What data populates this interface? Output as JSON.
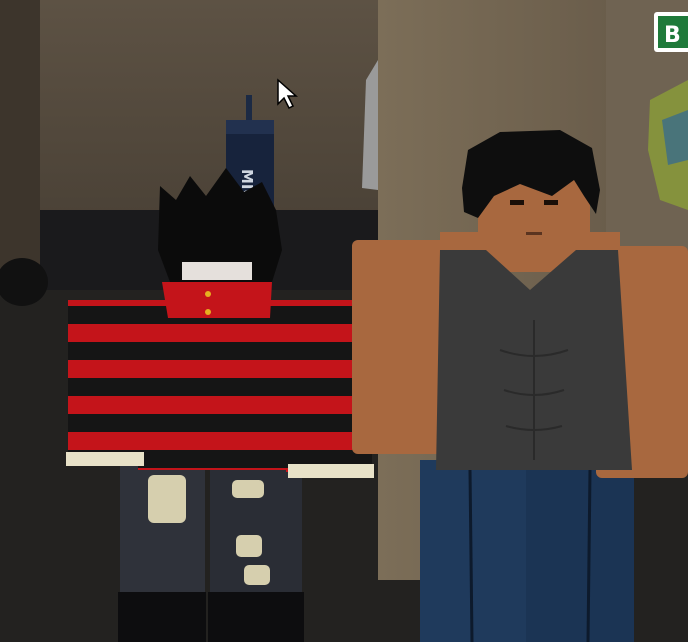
{
  "scene": {
    "type": "game-screenshot",
    "setting": "gym-interior",
    "sign_text": "B",
    "punching_bag_text": "MIC",
    "colors": {
      "wall": "#6e6250",
      "wall_dark": "#4a4136",
      "floor": "#232220",
      "sign_green": "#1f7a3a",
      "sweater_red": "#c4141a",
      "sweater_black": "#151515",
      "skin": "#a8683f",
      "tank_top": "#3a3a3a",
      "jeans": "#1f3a5c"
    }
  },
  "characters": [
    {
      "name": "striped-sweater-avatar",
      "items": [
        "black-messy-hair",
        "red-turtleneck",
        "red-black-striped-sweater",
        "ripped-grey-jeans"
      ]
    },
    {
      "name": "muscular-avatar",
      "items": [
        "black-dreadlocks",
        "grey-tank-top",
        "blue-jeans"
      ]
    }
  ],
  "cursor": {
    "icon": "mouse-pointer-icon"
  }
}
